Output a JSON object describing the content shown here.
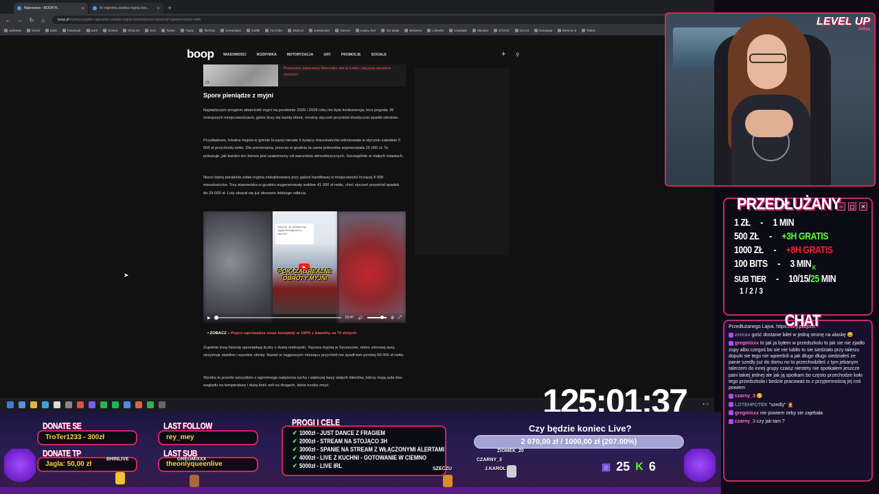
{
  "browser": {
    "tabs": [
      {
        "title": "Najnowsze - BOOP.PL",
        "active": true
      },
      {
        "title": "Ile najmniej zarabia myjnia bez...",
        "active": false
      }
    ],
    "url_domain": "boop.pl",
    "url_path": "/motoryzacja/ile-naprawde-zarabia-myjnia-bezdotykowa-wlasciciel-ujawnia-kwoty-netto",
    "bookmarks": [
      "Aplikacje",
      "Gmail",
      "Dysk",
      "Facebook",
      "work",
      "Oculus",
      "ShinLive",
      "Kick",
      "Twitter",
      "Tipply",
      "TikTinky",
      "Streamlabs",
      "Grafik",
      "YouTube",
      "JBZD.pl",
      "JoeMonster",
      "Games",
      "Łowcy Gier",
      "GG.deals",
      "Behance",
      "LinkedIn",
      "Unsplash",
      "Skinden",
      "STOCK",
      "Gry tnt",
      "Norwegia",
      "Memory 5",
      "Twitch"
    ]
  },
  "site": {
    "logo": "boop",
    "nav": [
      "WIADOMOŚCI",
      "ROZRYWKA",
      "MOTORYZACJA",
      "GRY",
      "PROMOCJE",
      "SOCIALE"
    ],
    "plus": "+",
    "search_glyph": "⚲"
  },
  "article": {
    "thumb_caption": "23",
    "thumb_link": "Porzucony luksusowy Mercedes stoi w Łodzi i zaczyna wyraźnie niszczeć",
    "heading": "Spore pieniądze z myjni",
    "p1": "Największym wrogiem właścicieli myjni na przełomie 2025 i 2026 roku nie była konkurencja, lecz pogoda. W mniejszych miejscowościach, gdzie liczy się każdy klient, mroźny styczeń przyniósł drastyczne spadki obrotów.",
    "p2": "Przykładowo, lokalna myjnia w gminie liczącej niecałe 5 tysięcy mieszkańców odnotowała w styczniu zaledwie 5 000 zł przychodu netto. Dla porównania, jeszcze w grudniu ta sama jednostka wypracowała 15 000 zł. To pokazuje, jak bardzo ten biznes jest uzależniony od warunków atmosferycznych. Szczególnie w małych miastach.",
    "p3": "Nieco lepiej poradziła sobie myjnia zlokalizowana przy galerii handlowej w miejscowości liczącej 4 000 mieszkańców. Trzy stanowiska w grudniu wygenerowały solidne 41 000 zł netto, choć styczeń przyniósł spadek do 29 000 zł. Luty okazał się już okresem lekkiego odbicia.",
    "video_card": "KaspCat · Ile zarobiła moja myjnia bezdotykowa w styczniu?",
    "video_title": "POKAZAŁ REALNE OBROTY MYJNI",
    "video_time": "01:47",
    "bullet_prefix": "ZOBACZ – ",
    "bullet_link": "Pepco wprowadza nowe komplety w 100% z bawełny za 70 złotych",
    "p4": "Zupełnie inną historię opowiadają liczby z dużej metropolii. Topowa myjnia w Szczecinie, mimo zimowej aury, utrzymuje stabilne i wysokie obroty. Nawet w najgorszym miesiącu przychód nie spadł tam poniżej 50 000 zł netto.",
    "p5": "Wynika to przede wszystkim z ogromnego natężenia ruchu i większej bazy stałych klientów, którzy myją auta bez względu na temperaturę i dużą ilość soli na drogach, która trzeba zmyć."
  },
  "webcam": {
    "logo": "LEVEL UP",
    "logo_sub": "JuRsa"
  },
  "extension": {
    "title": "PRZEDŁUŻANY",
    "rows": [
      {
        "amount": "1 ZŁ",
        "value": "1 MIN"
      },
      {
        "amount": "500 ZŁ",
        "value": "+3H GRATIS"
      },
      {
        "amount": "1000 ZŁ",
        "value": "+8H GRATIS"
      },
      {
        "amount": "100 BITS",
        "value": "3 MIN"
      },
      {
        "amount": "SUB TIER",
        "value_a": "10/15/",
        "value_b": "25",
        "value_c": " MIN"
      }
    ],
    "dash": "-",
    "tier_sub": "1 / 2 / 3",
    "kick_k": "K"
  },
  "chat": {
    "title": "CHAT",
    "messages": [
      {
        "user": "",
        "text": "Przedłużanego Lajva. https://tiny.pl/cjonx"
      },
      {
        "user": "zzeczu",
        "text": "gość dostanie bilet w jedną stronę na alaskę 😅"
      },
      {
        "user": "gregmixxx",
        "text": "to jak ja byłem w przedszkolu to jak sie nie zjadło zupy albo czegoś bo sie nie lubiło to sie siedziało przy talerzu dopuki sie tego nie wpierdoli a jak długo długo siedziałeś ze panie szedly juz do domu no to przechodziłeś z tym jebanym talerzem do innej grupy czaisz niestety nie spotkałem jeszcze pani takiej jednej ale jak ją spotkam bo często przechodze koło tego przedszkola i bedzie pracować to z przyjemnością jej coś powiem"
      },
      {
        "user": "czarny_3",
        "text": "😊"
      },
      {
        "user": "LOTEHPOTEK",
        "text": "\"szedly\" 🤦"
      },
      {
        "user": "gregmixxx",
        "text": "nie powiem żeby sie zajebała"
      },
      {
        "user": "czarny_3",
        "text": "czy jak tam ?"
      }
    ]
  },
  "timer": "125:01:37",
  "overlay": {
    "donate_se_label": "DONATE SE",
    "donate_se_value": "TroTer1233 - 300zł",
    "donate_tp_label": "DONATE TP",
    "donate_tp_value": "Jagla: 50,00 zł",
    "last_follow_label": "LAST FOLLOW",
    "last_follow_value": "rey_mey",
    "last_sub_label": "LAST SUB",
    "last_sub_value": "theonlyqueenlive",
    "progi_title": "PROGI I CELE",
    "progi": [
      "1000zł - JUST DANCE Z FRAGIEM",
      "2000zł - STREAM NA STOJĄCO 3H",
      "3000zł - SPANIE NA STREAM Z WŁĄCZONYMI ALERTAMI",
      "4000zł - LIVE Z KUCHNI - GOTOWANIE W CIEMNO",
      "5000zł - LIVE IRL"
    ],
    "checkmark": "✔",
    "goal_title": "Czy będzie koniec Live?",
    "goal_text": "2 070,00 zł / 1000,00 zł (207.00%)",
    "goal_progress": 1.0,
    "twitch_count": "25",
    "kick_count": "6",
    "game_names": [
      "BHINLIVE",
      "GREGMIXXX",
      "ZIOMEK_20",
      "CZARNY_3",
      "SZECZU",
      "J.KAROL"
    ]
  }
}
